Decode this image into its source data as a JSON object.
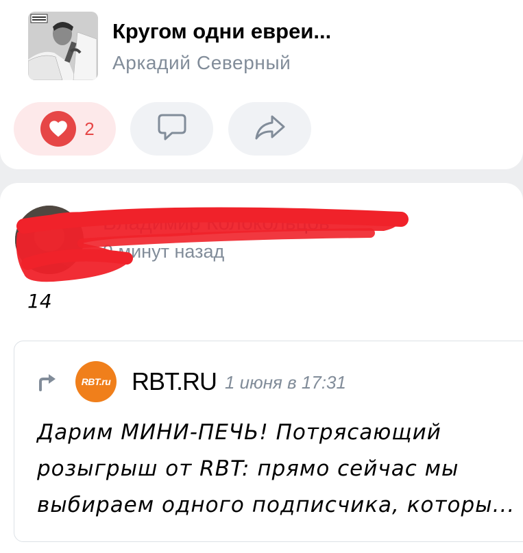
{
  "track": {
    "title": "Кругом одни евреи...",
    "artist": "Аркадий Северный"
  },
  "actions": {
    "like_count": "2",
    "accent_color": "#e64646"
  },
  "comment": {
    "author": "Владимир Колокольцов",
    "time": "9 минут назад",
    "text": "14"
  },
  "repost": {
    "group_logo_text": "RBT.ru",
    "group_name": "RBT.RU",
    "date": "1 июня в 17:31",
    "text": "Дарим МИНИ-ПЕЧЬ!  Потрясающий розыгрыш от RBT: прямо сейчас мы выбираем одного подписчика, которы..."
  }
}
